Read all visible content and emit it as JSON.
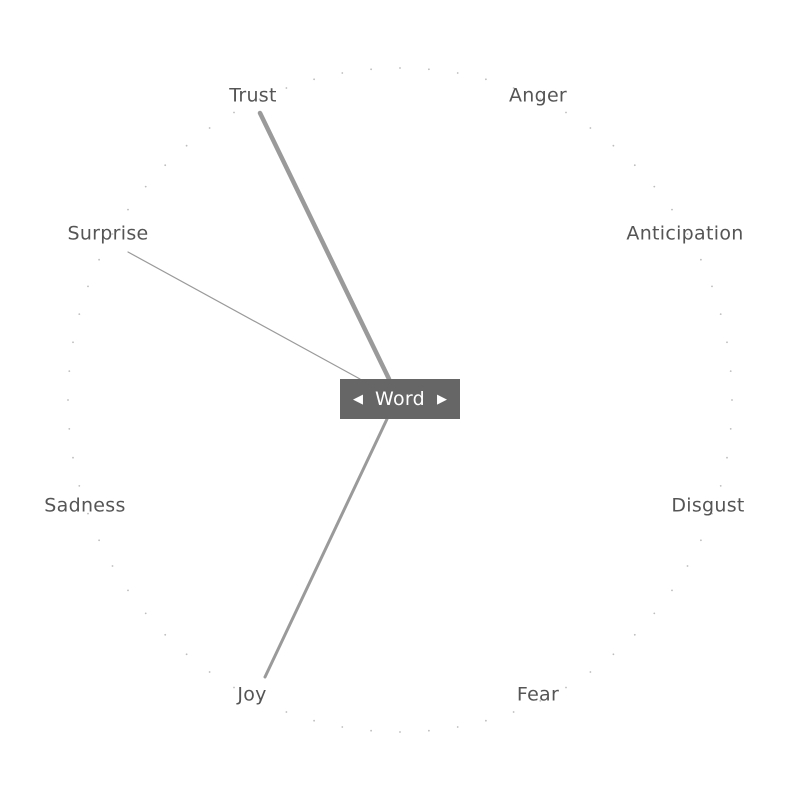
{
  "center_control": {
    "word": "Word",
    "prev_arrow": "◀",
    "next_arrow": "▶"
  },
  "emotions": [
    {
      "label": "Trust",
      "weight": 1.0
    },
    {
      "label": "Anger",
      "weight": 0
    },
    {
      "label": "Anticipation",
      "weight": 0
    },
    {
      "label": "Disgust",
      "weight": 0
    },
    {
      "label": "Fear",
      "weight": 0
    },
    {
      "label": "Joy",
      "weight": 0.6
    },
    {
      "label": "Sadness",
      "weight": 0
    },
    {
      "label": "Surprise",
      "weight": 0.2
    }
  ],
  "colors": {
    "spoke": "#9a9a9a",
    "center_box": "#666666",
    "label_text": "#555555"
  }
}
